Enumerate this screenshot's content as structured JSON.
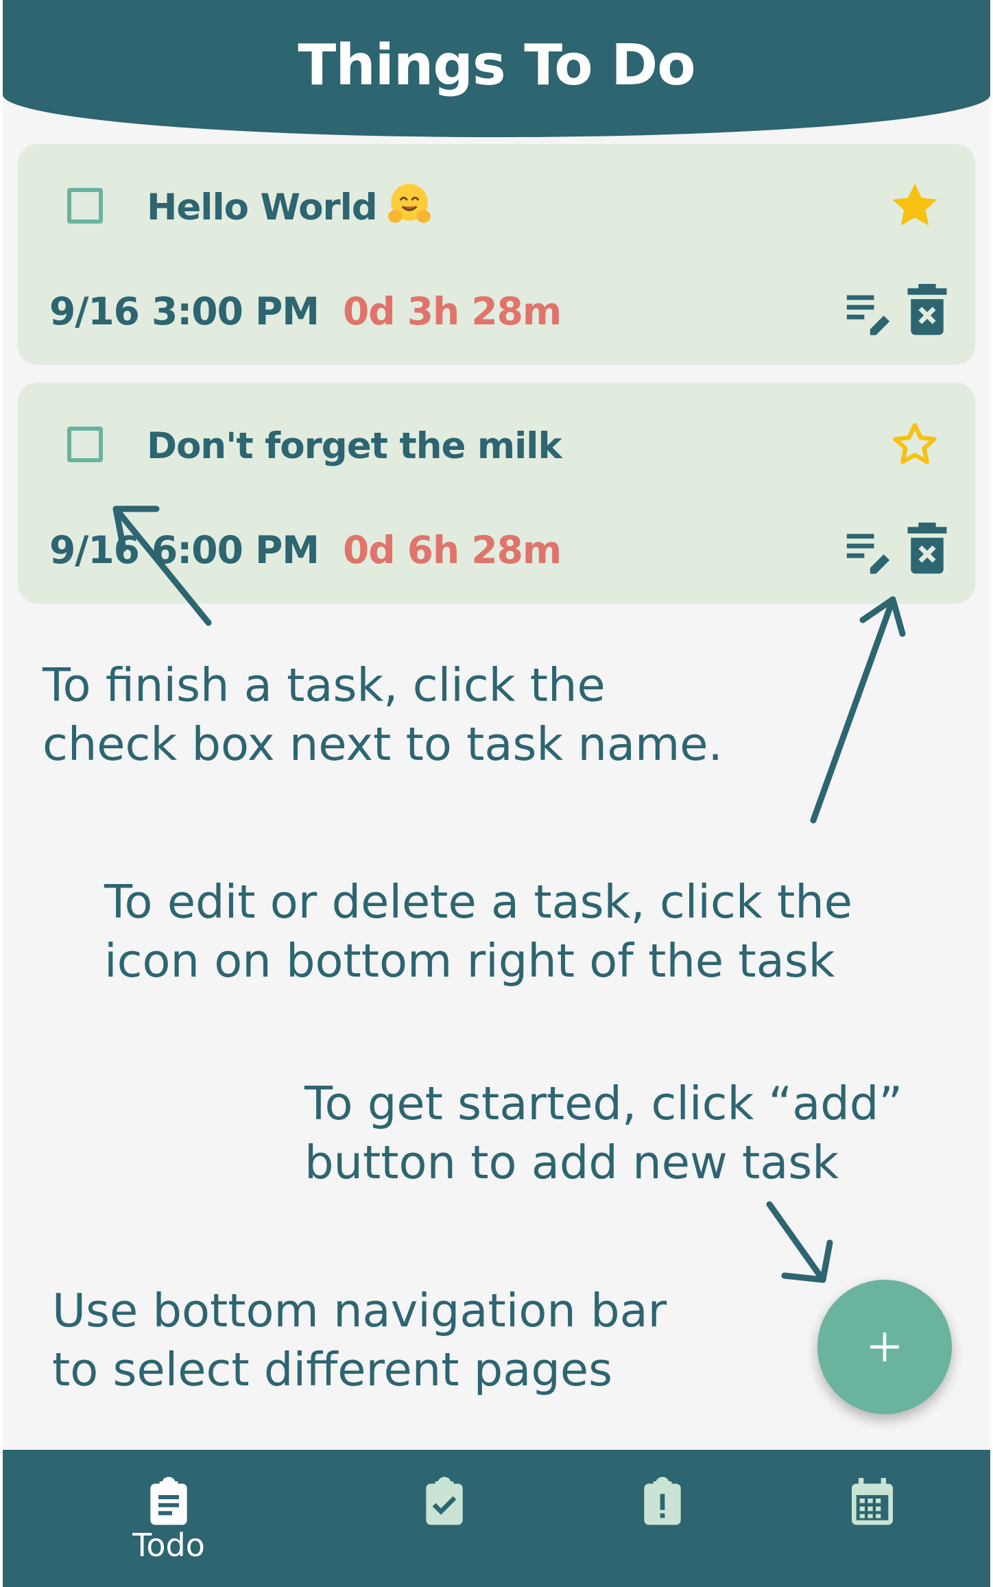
{
  "app": {
    "title": "Things To Do"
  },
  "tasks": [
    {
      "title": "Hello World",
      "emoji": "hugging-face",
      "starred": true,
      "date": "9/16 3:00 PM",
      "remaining": "0d 3h 28m"
    },
    {
      "title": "Don't forget the milk",
      "starred": false,
      "date": "9/16 6:00 PM",
      "remaining": "0d 6h 28m"
    }
  ],
  "help": {
    "finish": "To finish a task, click the\ncheck box next to task name.",
    "edit": "To edit or delete a task, click the\nicon on bottom right of the task",
    "add": "To get started, click “add”\nbutton to add new task",
    "nav": "Use bottom navigation bar\nto select different pages"
  },
  "fab": {
    "icon": "plus-icon"
  },
  "nav": {
    "items": [
      {
        "icon": "clipboard-list-icon",
        "label": "Todo",
        "active": true
      },
      {
        "icon": "clipboard-check-icon",
        "label": "",
        "active": false
      },
      {
        "icon": "clipboard-alert-icon",
        "label": "",
        "active": false
      },
      {
        "icon": "calendar-icon",
        "label": "",
        "active": false
      }
    ]
  },
  "colors": {
    "primary": "#2d6571",
    "card": "#e1ecdf",
    "accent": "#6ab39e",
    "star": "#f6c112",
    "remaining": "#e0746c",
    "background": "#f5f5f5"
  }
}
